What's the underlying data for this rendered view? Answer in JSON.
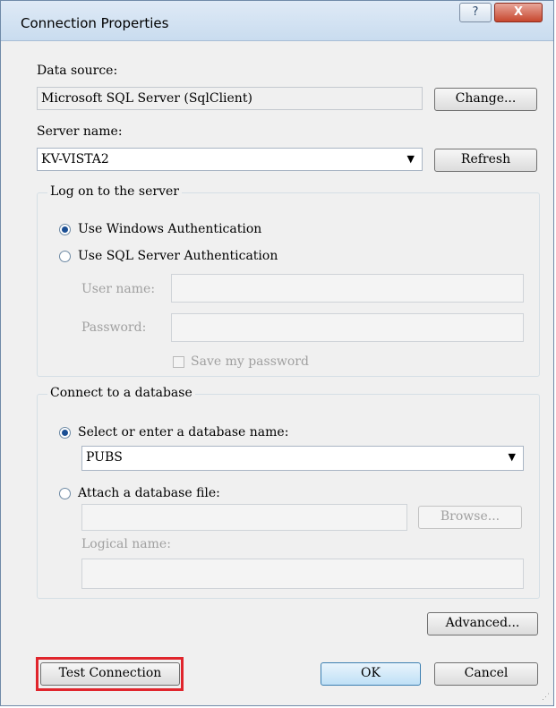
{
  "window": {
    "title": "Connection Properties",
    "help": "?",
    "close": "X"
  },
  "data_source": {
    "label": "Data source:",
    "value": "Microsoft SQL Server (SqlClient)",
    "change_button": "Change..."
  },
  "server": {
    "label": "Server name:",
    "value": "KV-VISTA2",
    "refresh_button": "Refresh"
  },
  "logon": {
    "title": "Log on to the server",
    "windows_auth": "Use Windows Authentication",
    "sql_auth": "Use SQL Server Authentication",
    "user_label": "User name:",
    "password_label": "Password:",
    "save_password": "Save my password",
    "selected": "windows"
  },
  "database": {
    "title": "Connect to a database",
    "select_option": "Select or enter a database name:",
    "db_value": "PUBS",
    "attach_option": "Attach a database file:",
    "browse_button": "Browse...",
    "logical_label": "Logical name:"
  },
  "buttons": {
    "advanced": "Advanced...",
    "test": "Test Connection",
    "ok": "OK",
    "cancel": "Cancel"
  },
  "colors": {
    "highlight": "#e0252c"
  }
}
